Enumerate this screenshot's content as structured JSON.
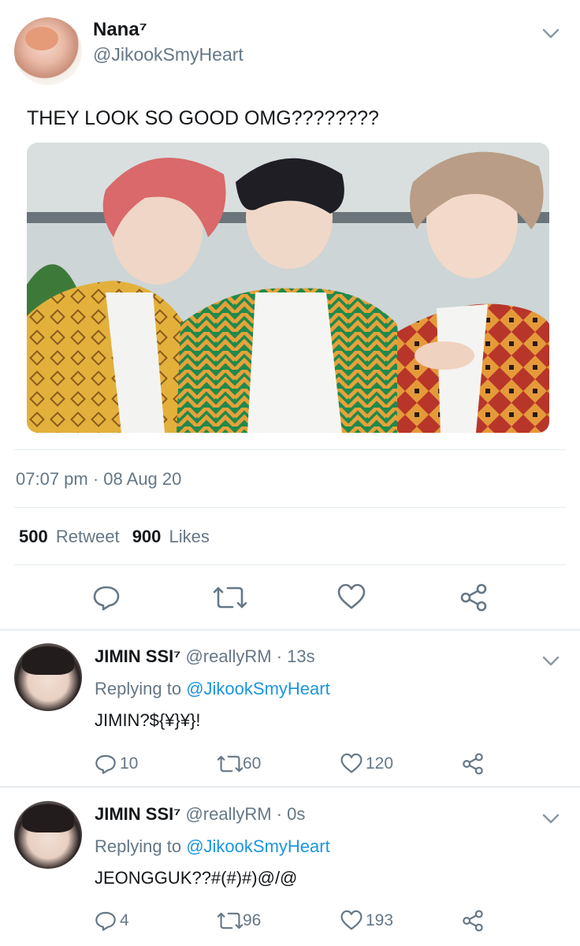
{
  "colors": {
    "accent": "#1b95e0",
    "muted": "#657786",
    "text": "#14171a",
    "divider": "#e6ecf0"
  },
  "main_tweet": {
    "name": "Nana⁷",
    "handle": "@JikookSmyHeart",
    "text": "THEY LOOK SO GOOD OMG????????",
    "time": "07:07 pm · 08 Aug 20",
    "retweet_count": "500",
    "retweet_label": "Retweet",
    "like_count": "900",
    "like_label": "Likes",
    "actions": [
      "reply-icon",
      "retweet-icon",
      "like-icon",
      "share-icon"
    ]
  },
  "replies": [
    {
      "name": "JIMIN SSI⁷",
      "handle": "@reallyRM",
      "time": "· 13s",
      "replying_prefix": "Replying to",
      "replying_handle": "@JikookSmyHeart",
      "text": "JIMIN?${¥}¥}!",
      "reply_count": "10",
      "retweet_count": "60",
      "like_count": "120"
    },
    {
      "name": "JIMIN SSI⁷",
      "handle": "@reallyRM",
      "time": "· 0s",
      "replying_prefix": "Replying to",
      "replying_handle": "@JikookSmyHeart",
      "text": "JEONGGUK??#(#)#)@/@",
      "reply_count": "4",
      "retweet_count": "96",
      "like_count": "193"
    }
  ]
}
